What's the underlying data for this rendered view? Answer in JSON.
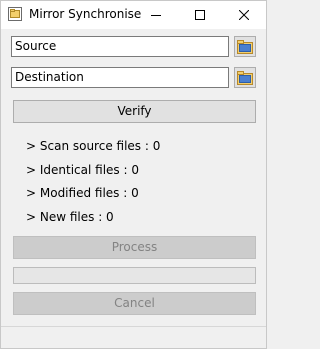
{
  "window": {
    "title": "Mirror Synchronise",
    "app_icon": "folder-sync-icon"
  },
  "fields": {
    "source_value": "Source",
    "destination_value": "Destination"
  },
  "buttons": {
    "verify_label": "Verify",
    "process_label": "Process",
    "cancel_label": "Cancel"
  },
  "stats": {
    "scan_source": "> Scan source files : 0",
    "identical": "> Identical files : 0",
    "modified": "> Modified files : 0",
    "new_files": "> New files : 0"
  },
  "progress": {
    "value": 0
  },
  "colors": {
    "window_bg": "#f0f0f0",
    "titlebar_bg": "#ffffff",
    "folder_icon": "#e8b84a",
    "progress_fill": "#06b025"
  }
}
